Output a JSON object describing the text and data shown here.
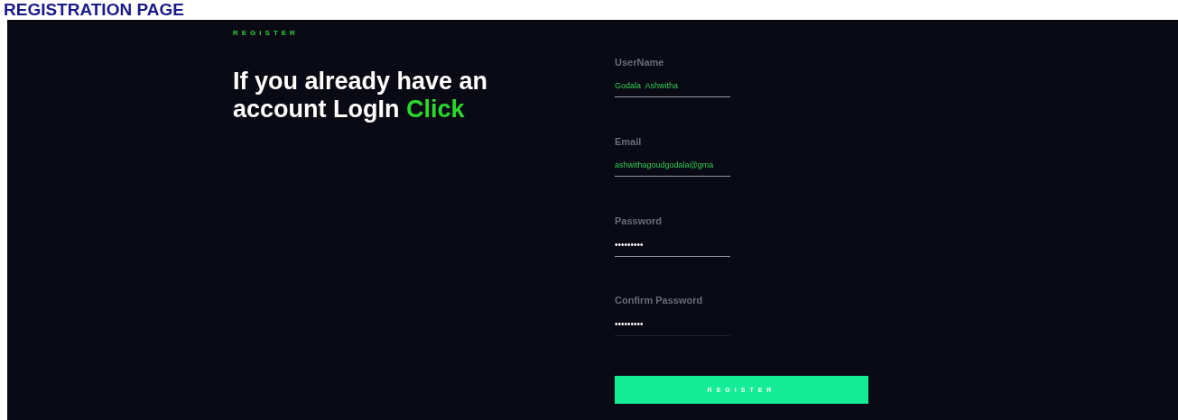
{
  "page_title": "REGISTRATION PAGE",
  "eyebrow": "REGISTER",
  "heading": {
    "text": "If you already have an account LogIn",
    "link": "Click"
  },
  "fields": [
    {
      "label": "UserName",
      "value": "Godala  Ashwitha",
      "kind": "text"
    },
    {
      "label": "Email",
      "value": "ashwithagoudgodala@gma",
      "kind": "text"
    },
    {
      "label": "Password",
      "value": "•••••••••",
      "kind": "password"
    },
    {
      "label": "Confirm Password",
      "value": "•••••••••",
      "kind": "password"
    }
  ],
  "submit": "REGISTER"
}
